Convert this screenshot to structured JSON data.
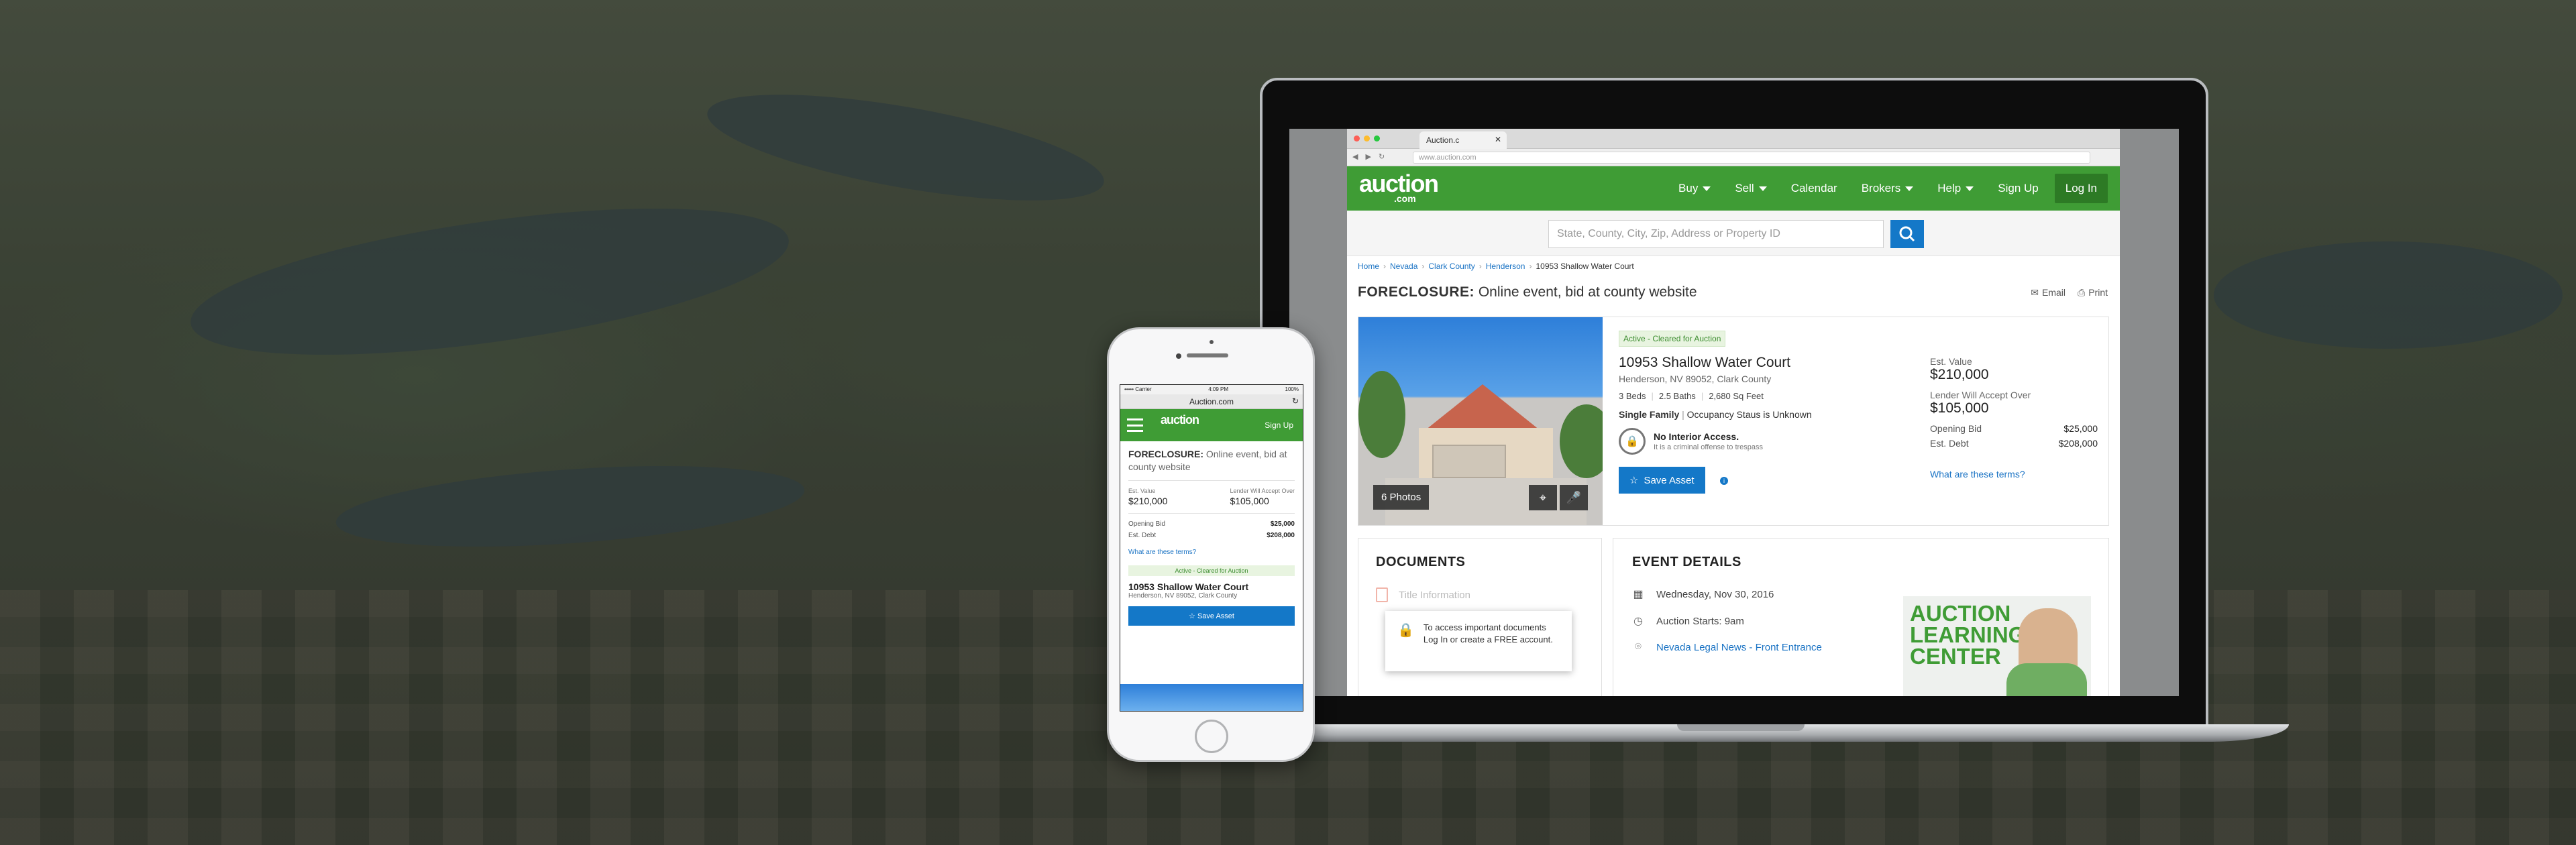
{
  "browser": {
    "tab_title": "Auction.c",
    "url": "www.auction.com",
    "nav_buttons": "◀ ▶ ↻"
  },
  "site": {
    "logo": "auction",
    "logo_sub": ".com",
    "menu": [
      "Buy",
      "Sell",
      "Calendar",
      "Brokers",
      "Help",
      "Sign Up"
    ],
    "login": "Log In",
    "search_placeholder": "State, County, City, Zip, Address or Property ID"
  },
  "breadcrumb": {
    "items": [
      "Home",
      "Nevada",
      "Clark County",
      "Henderson"
    ],
    "current": "10953 Shallow Water Court"
  },
  "page": {
    "title_strong": "FORECLOSURE:",
    "title_rest": "Online event, bid at county website",
    "email": "Email",
    "print": "Print"
  },
  "property": {
    "photos_badge": "6 Photos",
    "status": "Active - Cleared for Auction",
    "address": "10953 Shallow Water Court",
    "city": "Henderson, NV 89052, Clark County",
    "beds": "3 Beds",
    "baths": "2.5 Baths",
    "sqft": "2,680 Sq Feet",
    "type_strong": "Single Family",
    "type_rest": "Occupancy Staus is Unknown",
    "no_interior_title": "No Interior Access.",
    "no_interior_sub": "It is a criminal offense to trespass",
    "save_label": "Save Asset"
  },
  "values": {
    "est_value_label": "Est. Value",
    "est_value": "$210,000",
    "lender_label": "Lender Will Accept Over",
    "lender": "$105,000",
    "opening_bid_label": "Opening Bid",
    "opening_bid": "$25,000",
    "est_debt_label": "Est. Debt",
    "est_debt": "$208,000",
    "terms_link": "What are these terms?"
  },
  "documents": {
    "title": "DOCUMENTS",
    "item": "Title Information",
    "popup_line1": "To access important documents",
    "popup_line2": "Log In or create a FREE account."
  },
  "events": {
    "title": "EVENT DETAILS",
    "date": "Wednesday, Nov 30, 2016",
    "starts": "Auction Starts:  9am",
    "location": "Nevada Legal News - Front Entrance",
    "learning": "AUCTION LEARNING CENTER"
  },
  "phone": {
    "carrier": "••••• Carrier",
    "time": "4:09 PM",
    "battery": "100%",
    "url": "Auction.com",
    "logo": "auction",
    "signup": "Sign Up",
    "title_strong": "FORECLOSURE:",
    "title_rest": "Online event, bid at county website",
    "est_value_label": "Est. Value",
    "est_value": "$210,000",
    "lender_label": "Lender Will Accept Over",
    "lender": "$105,000",
    "opening_bid_label": "Opening Bid",
    "opening_bid": "$25,000",
    "est_debt_label": "Est. Debt",
    "est_debt": "$208,000",
    "terms_link": "What are these terms?",
    "status": "Active - Cleared for Auction",
    "address": "10953 Shallow Water Court",
    "city": "Henderson, NV 89052, Clark County",
    "save_label": "Save Asset"
  },
  "colors": {
    "brand_green": "#3f9c35",
    "link_blue": "#1a73c4",
    "button_blue": "#1478c8"
  }
}
